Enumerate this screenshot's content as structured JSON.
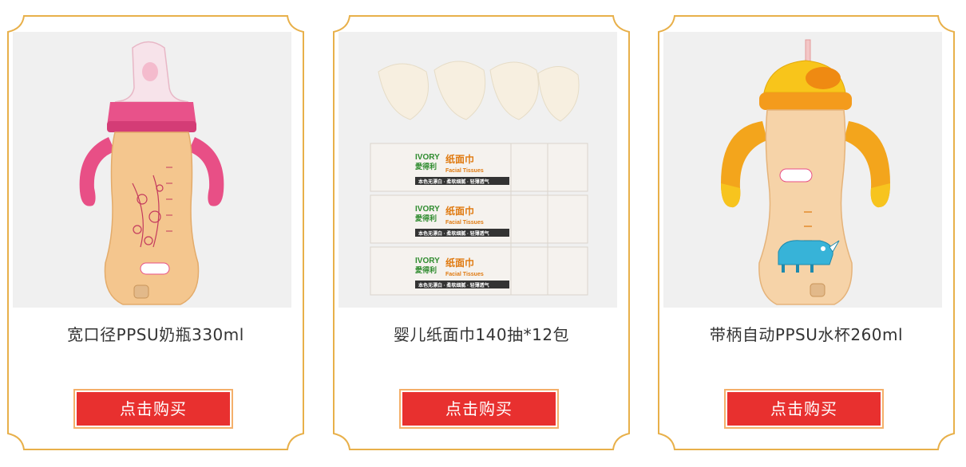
{
  "colors": {
    "frame_gold": "#e8b04a",
    "button_red": "#e8302f",
    "button_border": "#f4b06a",
    "image_bg": "#f0f0f0",
    "title_text": "#333333"
  },
  "products": [
    {
      "title": "宽口径PPSU奶瓶330ml",
      "button_label": "点击购买",
      "image": "pink-baby-bottle"
    },
    {
      "title": "婴儿纸面巾140抽*12包",
      "button_label": "点击购买",
      "image": "tissue-packs"
    },
    {
      "title": "带柄自动PPSU水杯260ml",
      "button_label": "点击购买",
      "image": "orange-sippy-cup"
    }
  ],
  "product_images": {
    "tissue_brand_en": "IVORY",
    "tissue_brand_cn": "愛得利",
    "tissue_name_cn": "纸面巾",
    "tissue_name_en": "Facial Tissues",
    "tissue_tagline": "本色无漂白 · 柔软细腻 · 轻薄透气"
  }
}
